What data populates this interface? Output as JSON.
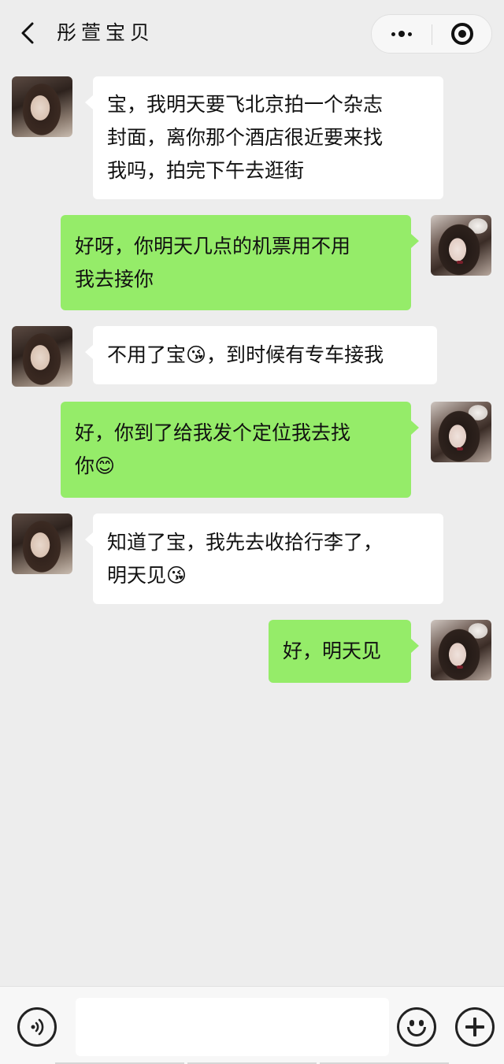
{
  "header": {
    "title": "彤萱宝贝",
    "back_icon": "chevron-left-icon",
    "more_icon": "more-dots-icon",
    "close_icon": "target-close-icon"
  },
  "messages": [
    {
      "side": "left",
      "text": "宝，我明天要飞北京拍一个杂志封面，离你那个酒店很近要来找我吗，拍完下午去逛街"
    },
    {
      "side": "right",
      "text": "好呀，你明天几点的机票用不用我去接你"
    },
    {
      "side": "left",
      "text": "不用了宝😘，到时候有专车接我"
    },
    {
      "side": "right",
      "text": "好，你到了给我发个定位我去找你😊"
    },
    {
      "side": "left",
      "text": "知道了宝，我先去收拾行李了，明天见😘"
    },
    {
      "side": "right",
      "text": "好，明天见"
    }
  ],
  "bubbles": {
    "m1": "宝，我明天要飞北京拍一个杂志\n封面，离你那个酒店很近要来找\n我吗，拍完下午去逛街",
    "m2": "好呀，你明天几点的机票用不用\n我去接你",
    "m3": "不用了宝😘，到时候有专车接我",
    "m4": "好，你到了给我发个定位我去找\n你😊",
    "m5": "知道了宝，我先去收拾行李了，\n明天见😘",
    "m6": "好，明天见"
  },
  "input_bar": {
    "placeholder": "",
    "voice_icon": "voice-icon",
    "emoji_icon": "emoji-icon",
    "plus_icon": "plus-icon"
  },
  "colors": {
    "background": "#ededed",
    "bubble_self": "#95ec69",
    "bubble_other": "#ffffff"
  }
}
